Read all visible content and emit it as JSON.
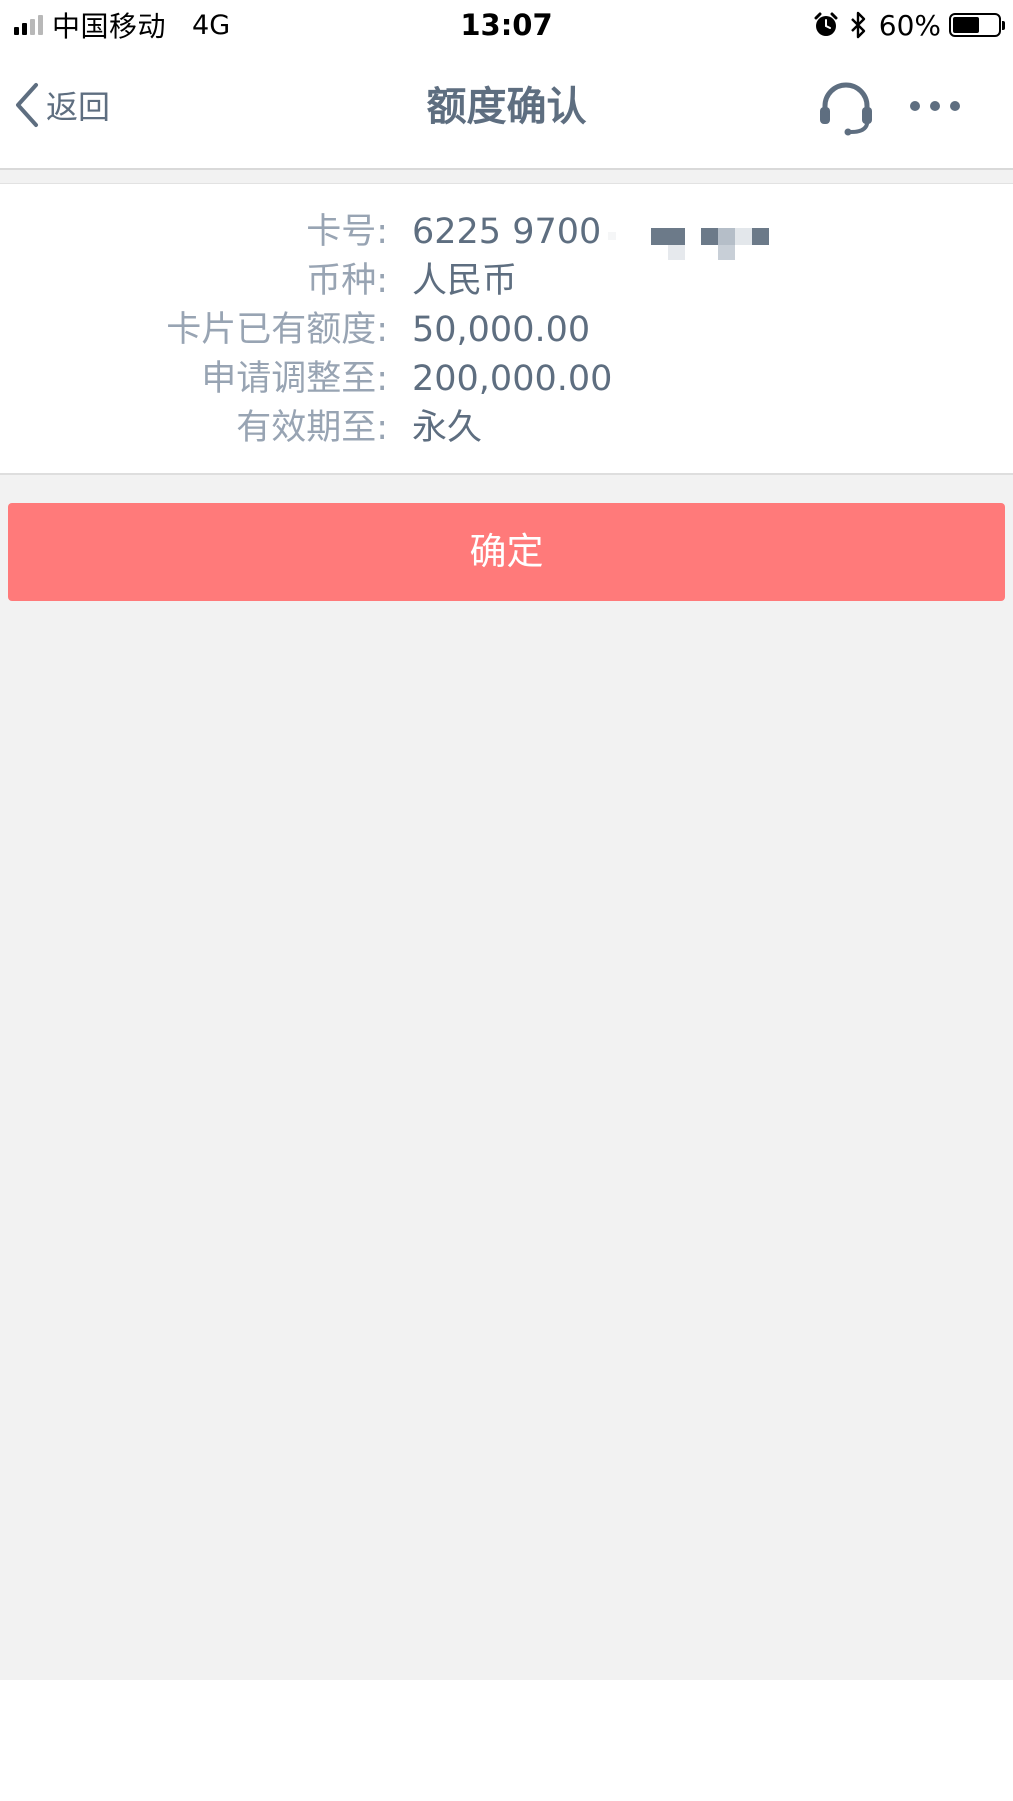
{
  "status_bar": {
    "carrier": "中国移动",
    "network": "4G",
    "time": "13:07",
    "battery_percent": "60%",
    "battery_level": 0.6,
    "signal_bars_filled": 2,
    "signal_bars_total": 4,
    "icons": [
      "alarm-icon",
      "bluetooth-icon",
      "battery-icon"
    ]
  },
  "nav": {
    "back_label": "返回",
    "title": "额度确认",
    "icons": [
      "chevron-left-icon",
      "headset-icon",
      "more-icon"
    ]
  },
  "details": {
    "card_number": {
      "label": "卡号:",
      "value": "6225 9700"
    },
    "currency": {
      "label": "币种:",
      "value": "人民币"
    },
    "current_limit": {
      "label": "卡片已有额度:",
      "value": "50,000.00"
    },
    "requested_limit": {
      "label": "申请调整至:",
      "value": "200,000.00"
    },
    "valid_until": {
      "label": "有效期至:",
      "value": "永久"
    }
  },
  "actions": {
    "confirm_label": "确定"
  },
  "colors": {
    "accent": "#ff7a7a",
    "label_text": "#98a4b3",
    "value_text": "#5e6e80",
    "background": "#f2f2f2"
  }
}
